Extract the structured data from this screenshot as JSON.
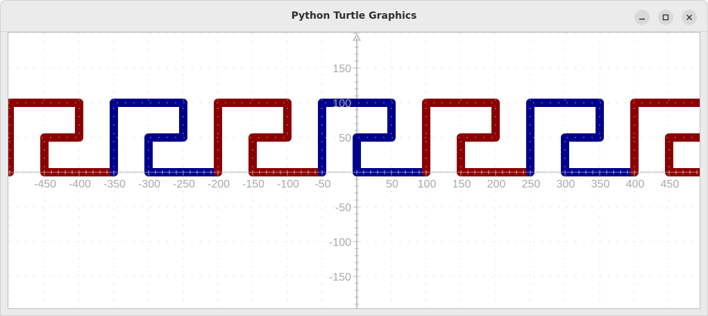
{
  "window": {
    "title": "Python Turtle Graphics",
    "buttons": [
      "minimize",
      "maximize",
      "close"
    ]
  },
  "colors": {
    "red": "#8b0000",
    "blue": "#00008b",
    "axis": "#b0b0b0",
    "grid": "#b5b5b5",
    "tick_label": "#a9a9a9"
  },
  "chart_data": {
    "type": "line",
    "title": "",
    "xlabel": "",
    "ylabel": "",
    "xlim": [
      -500,
      500
    ],
    "ylim": [
      -200,
      200
    ],
    "grid": true,
    "x_ticks": [
      -450,
      -400,
      -350,
      -300,
      -250,
      -200,
      -150,
      -100,
      -50,
      50,
      100,
      150,
      200,
      250,
      300,
      350,
      400,
      450
    ],
    "y_ticks": [
      150,
      100,
      50,
      -50,
      -100,
      -150
    ],
    "x_tick_labels": [
      "-450",
      "-400",
      "-350",
      "-300",
      "-250",
      "-200",
      "-150",
      "-100",
      "-50",
      "50",
      "100",
      "150",
      "200",
      "250",
      "300",
      "350",
      "400",
      "450"
    ],
    "y_tick_labels": [
      "150",
      "100",
      "50",
      "-50",
      "-100",
      "-150"
    ],
    "pen_width": 10,
    "segments": [
      {
        "color": "red",
        "points": [
          [
            -500,
            0
          ],
          [
            -500,
            100
          ],
          [
            -400,
            100
          ],
          [
            -400,
            50
          ],
          [
            -450,
            50
          ],
          [
            -450,
            0
          ],
          [
            -350,
            0
          ]
        ]
      },
      {
        "color": "blue",
        "points": [
          [
            -350,
            0
          ],
          [
            -350,
            100
          ],
          [
            -250,
            100
          ],
          [
            -250,
            50
          ],
          [
            -300,
            50
          ],
          [
            -300,
            0
          ],
          [
            -200,
            0
          ]
        ]
      },
      {
        "color": "red",
        "points": [
          [
            -200,
            0
          ],
          [
            -200,
            100
          ],
          [
            -100,
            100
          ],
          [
            -100,
            50
          ],
          [
            -150,
            50
          ],
          [
            -150,
            0
          ],
          [
            -50,
            0
          ]
        ]
      },
      {
        "color": "blue",
        "points": [
          [
            -50,
            0
          ],
          [
            -50,
            100
          ],
          [
            50,
            100
          ],
          [
            50,
            50
          ],
          [
            0,
            50
          ],
          [
            0,
            0
          ],
          [
            100,
            0
          ]
        ]
      },
      {
        "color": "red",
        "points": [
          [
            100,
            0
          ],
          [
            100,
            100
          ],
          [
            200,
            100
          ],
          [
            200,
            50
          ],
          [
            150,
            50
          ],
          [
            150,
            0
          ],
          [
            250,
            0
          ]
        ]
      },
      {
        "color": "blue",
        "points": [
          [
            250,
            0
          ],
          [
            250,
            100
          ],
          [
            350,
            100
          ],
          [
            350,
            50
          ],
          [
            300,
            50
          ],
          [
            300,
            0
          ],
          [
            400,
            0
          ]
        ]
      },
      {
        "color": "red",
        "points": [
          [
            400,
            0
          ],
          [
            400,
            100
          ],
          [
            500,
            100
          ],
          [
            500,
            50
          ],
          [
            450,
            50
          ],
          [
            450,
            0
          ],
          [
            500,
            0
          ]
        ]
      }
    ]
  }
}
